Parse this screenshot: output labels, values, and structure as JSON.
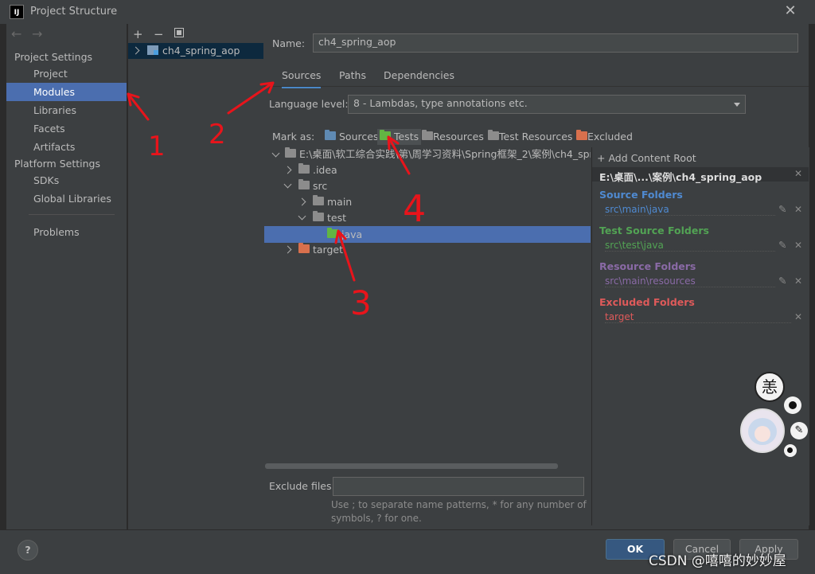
{
  "window": {
    "title": "Project Structure",
    "app_icon": "IJ"
  },
  "sidebar": {
    "project_settings_header": "Project Settings",
    "items_top": [
      {
        "label": "Project",
        "selected": false
      },
      {
        "label": "Modules",
        "selected": true
      },
      {
        "label": "Libraries",
        "selected": false
      },
      {
        "label": "Facets",
        "selected": false
      },
      {
        "label": "Artifacts",
        "selected": false
      }
    ],
    "platform_settings_header": "Platform Settings",
    "items_platform": [
      {
        "label": "SDKs"
      },
      {
        "label": "Global Libraries"
      }
    ],
    "problems": "Problems"
  },
  "modules": {
    "toolbar": [
      "+",
      "−",
      "copy"
    ],
    "items": [
      {
        "label": "ch4_spring_aop"
      }
    ]
  },
  "module": {
    "name_label": "Name:",
    "name_value": "ch4_spring_aop",
    "tabs": [
      {
        "label": "Sources",
        "selected": true
      },
      {
        "label": "Paths"
      },
      {
        "label": "Dependencies"
      }
    ],
    "language_level_label": "Language level:",
    "language_level_value": "8 - Lambdas, type annotations etc.",
    "mark_as_label": "Mark as:",
    "mark_as": [
      {
        "label": "Sources",
        "color": "#5f8ab3"
      },
      {
        "label": "Tests",
        "color": "#62b543"
      },
      {
        "label": "Resources",
        "color": "#8c8c8c"
      },
      {
        "label": "Test Resources",
        "color": "#8c8c8c"
      },
      {
        "label": "Excluded",
        "color": "#d8704d"
      }
    ]
  },
  "tree": {
    "root": "E:\\桌面\\软工综合实践\\第\\周学习资料\\Spring框架_2\\案例\\ch4_sprin",
    "nodes": [
      {
        "label": ".idea"
      },
      {
        "label": "src"
      },
      {
        "label": "main"
      },
      {
        "label": "test"
      },
      {
        "label": "java"
      },
      {
        "label": "target"
      }
    ]
  },
  "content_root": {
    "add_label": "+ Add Content Root",
    "root_path": "E:\\桌面\\...\\案例\\ch4_spring_aop",
    "sections": [
      {
        "title": "Source Folders",
        "path": "src\\main\\java",
        "color": "#4f8ad1"
      },
      {
        "title": "Test Source Folders",
        "path": "src\\test\\java",
        "color": "#52a354"
      },
      {
        "title": "Resource Folders",
        "path": "src\\main\\resources",
        "color": "#8a6aa6"
      },
      {
        "title": "Excluded Folders",
        "path": "target",
        "color": "#de5a5a"
      }
    ]
  },
  "exclude": {
    "label": "Exclude files:",
    "hint_line1": "Use ; to separate name patterns, * for any number of",
    "hint_line2": "symbols, ? for one."
  },
  "buttons": {
    "help": "?",
    "ok": "OK",
    "cancel": "Cancel",
    "apply": "Apply"
  },
  "watermark": "CSDN @嘻嘻的妙妙屋",
  "annotations": [
    "1",
    "2",
    "3",
    "4"
  ],
  "avatar_chars": {
    "top": "恙"
  }
}
